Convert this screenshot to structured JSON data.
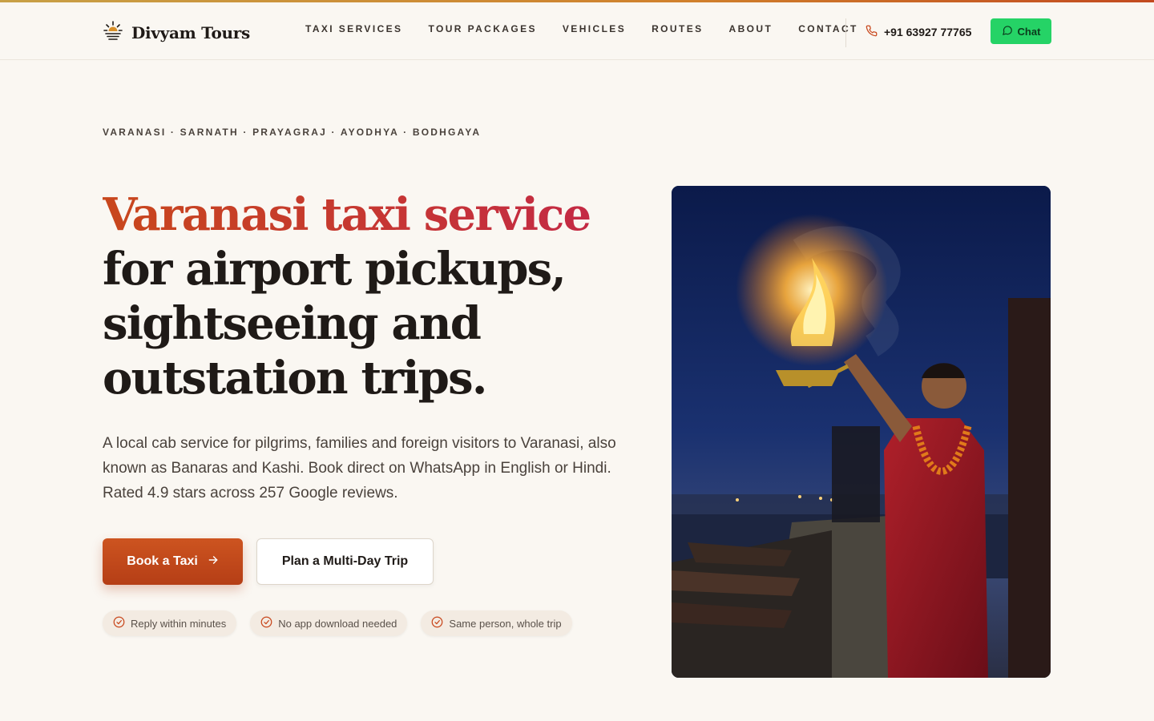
{
  "brand": {
    "name": "Divyam Tours",
    "logo_icon": "sun-rays-icon"
  },
  "nav": {
    "items": [
      "TAXI SERVICES",
      "TOUR PACKAGES",
      "VEHICLES",
      "ROUTES",
      "ABOUT",
      "CONTACT"
    ]
  },
  "contact": {
    "phone": "+91 63927 77765",
    "chat_label": "Chat"
  },
  "hero": {
    "eyebrow": "VARANASI · SARNATH · PRAYAGRAJ · AYODHYA · BODHGAYA",
    "title_accent": "Varanasi taxi service",
    "title_rest": " for airport pickups, sightseeing and outstation trips.",
    "lede": "A local cab service for pilgrims, families and foreign visitors to Varanasi, also known as Banaras and Kashi. Book direct on WhatsApp in English or Hindi. Rated 4.9 stars across 257 Google reviews.",
    "primary_cta": "Book a Taxi",
    "secondary_cta": "Plan a Multi-Day Trip",
    "badges": [
      "Reply within minutes",
      "No app download needed",
      "Same person, whole trip"
    ]
  },
  "colors": {
    "accent": "#c8471c",
    "accent_end": "#c42a44",
    "chat": "#25d366",
    "background": "#faf7f2"
  }
}
